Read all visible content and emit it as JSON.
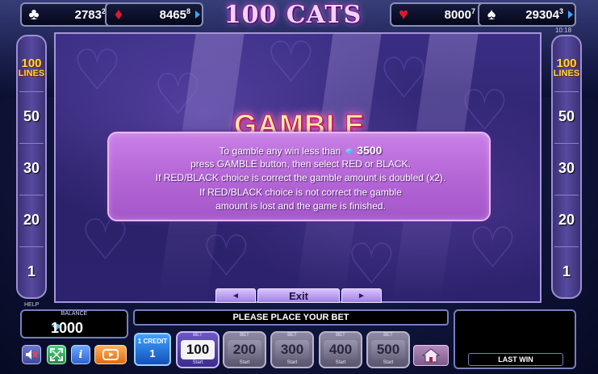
{
  "title": "100 CATS",
  "jackpots": [
    {
      "suit": "clubs",
      "symbol": "♣",
      "value": "2783",
      "cents": "2",
      "color": "#ffffff"
    },
    {
      "suit": "diamonds",
      "symbol": "♦",
      "value": "8465",
      "cents": "8",
      "color": "#e0182d"
    },
    {
      "suit": "hearts",
      "symbol": "♥",
      "value": "8000",
      "cents": "7",
      "color": "#e0182d"
    },
    {
      "suit": "spades",
      "symbol": "♠",
      "value": "29304",
      "cents": "3",
      "color": "#ffffff"
    }
  ],
  "clock": "10:18",
  "left_panel": {
    "badge_number": "100",
    "badge_text": "LINES",
    "lines": [
      "50",
      "30",
      "20",
      "1"
    ]
  },
  "right_panel": {
    "badge_number": "100",
    "badge_text": "LINES",
    "lines": [
      "50",
      "30",
      "20",
      "1"
    ]
  },
  "gamble": {
    "title": "GAMBLE",
    "line1_prefix": "To gamble any win less than",
    "line1_amount": "3500",
    "line2": "press GAMBLE button, then select RED or BLACK.",
    "line3": "If RED/BLACK choice is correct the gamble amount is doubled (x2).",
    "line4": "If RED/BLACK choice is not correct the gamble",
    "line5": "amount is lost and the game is finished."
  },
  "nav": {
    "prev": "◄",
    "exit": "Exit",
    "next": "►"
  },
  "bottom": {
    "help": "HELP",
    "balance_label": "BALANCE",
    "balance_value": "1000",
    "message": "PLEASE PLACE YOUR BET",
    "last_win_label": "LAST WIN",
    "credit_label": "1 CREDIT",
    "credit_value": "1",
    "bets": [
      {
        "tag": "BET",
        "value": "100",
        "sub": "Start",
        "active": true
      },
      {
        "tag": "BET",
        "value": "200",
        "sub": "Start",
        "active": false
      },
      {
        "tag": "BET",
        "value": "300",
        "sub": "Start",
        "active": false
      },
      {
        "tag": "BET",
        "value": "400",
        "sub": "Start",
        "active": false
      },
      {
        "tag": "BET",
        "value": "500",
        "sub": "Start",
        "active": false
      }
    ]
  },
  "colors": {
    "accent_yellow": "#ffdb2d",
    "gamble_panel": "#b566d6",
    "diamond": "#2b8fd6"
  }
}
